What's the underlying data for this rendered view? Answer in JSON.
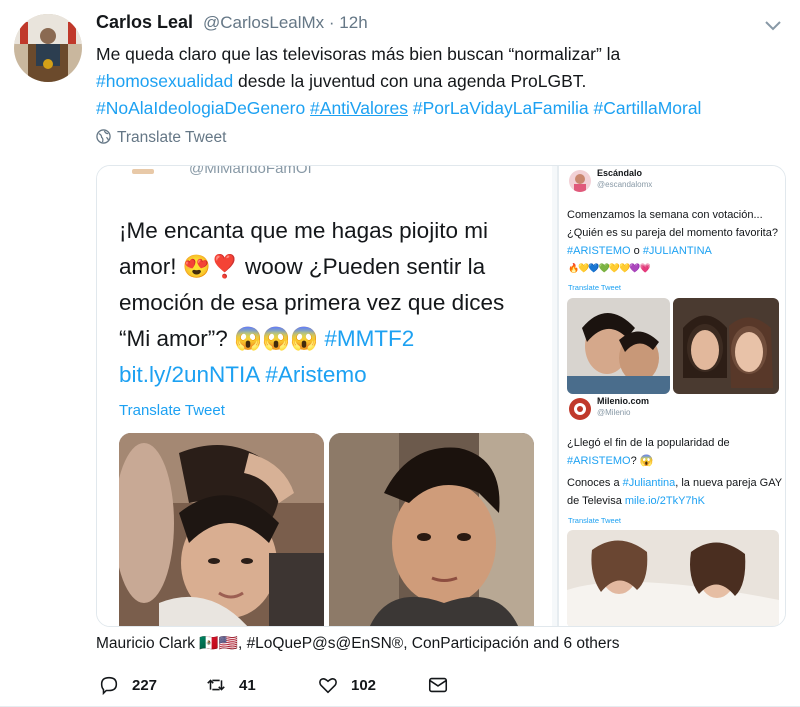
{
  "tweet": {
    "author_name": "Carlos Leal",
    "author_handle": "@CarlosLealMx",
    "time": "· 12h",
    "body": {
      "line1": "Me queda claro que las televisoras más bien buscan “normalizar” la",
      "line2_hashtag": "#homosexualidad",
      "line2_rest": " desde la juventud con una agenda ProLGBT.",
      "hashtags": [
        "#NoAlaIdeologiaDeGenero",
        "#AntiValores",
        "#PorLaVidayLaFamilia",
        "#CartillaMoral"
      ]
    },
    "translate_label": "Translate Tweet"
  },
  "media": {
    "left": {
      "cut_handle": "@MiMaridoFamOf",
      "text_1": "¡Me encanta que me hagas piojito mi amor! 😍❣️ woow ¿Pueden sentir la emoción de esa primera  vez que dices “Mi amor”? 😱😱😱 ",
      "text_tag": "#MMTF2",
      "text_link": "bit.ly/2unNTIA",
      "text_tag2": "#Aristemo",
      "translate_label": "Translate Tweet"
    },
    "right": {
      "t1": {
        "name": "Escándalo",
        "handle": "@escandalomx",
        "text_1": "Comenzamos la semana con votación... ¿Quién es su pareja del momento favorita? ",
        "tag1": "#ARISTEMO",
        "mid": " o ",
        "tag2": "#JULIANTINA",
        "hearts": "🔥💛💙💚💛💛💜💗",
        "translate_label": "Translate Tweet"
      },
      "t2": {
        "name": "Milenio.com",
        "handle": "@Milenio",
        "text_1": "¿Llegó el fin de la popularidad de ",
        "tag1": "#ARISTEMO",
        "text_2": "? 😱",
        "text_3": "Conoces a ",
        "tag2": "#Juliantina",
        "text_4": ", la nueva pareja GAY de Televisa ",
        "link": "mile.io/2TkY7hK",
        "translate_label": "Translate Tweet"
      }
    }
  },
  "context_line": "Mauricio Clark 🇲🇽🇺🇸, #LoQueP@s@EnSN®, ConParticipación and 6 others",
  "actions": {
    "replies": "227",
    "retweets": "41",
    "likes": "102"
  },
  "colors": {
    "link": "#1da1f2",
    "muted": "#657786",
    "text": "#14171a"
  }
}
